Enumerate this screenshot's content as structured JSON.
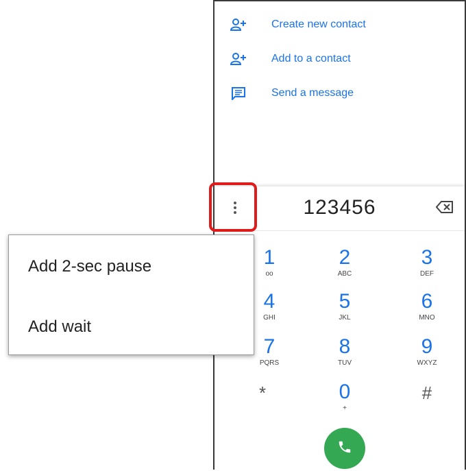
{
  "suggestions": [
    {
      "label": "Create new contact",
      "icon": "add-person-icon"
    },
    {
      "label": "Add to a contact",
      "icon": "add-person-icon"
    },
    {
      "label": "Send a message",
      "icon": "message-icon"
    }
  ],
  "dialer": {
    "number": "123456",
    "keys": [
      {
        "digit": "1",
        "letters": "oo"
      },
      {
        "digit": "2",
        "letters": "ABC"
      },
      {
        "digit": "3",
        "letters": "DEF"
      },
      {
        "digit": "4",
        "letters": "GHI"
      },
      {
        "digit": "5",
        "letters": "JKL"
      },
      {
        "digit": "6",
        "letters": "MNO"
      },
      {
        "digit": "7",
        "letters": "PQRS"
      },
      {
        "digit": "8",
        "letters": "TUV"
      },
      {
        "digit": "9",
        "letters": "WXYZ"
      },
      {
        "digit": "*",
        "letters": ""
      },
      {
        "digit": "0",
        "letters": "+"
      },
      {
        "digit": "#",
        "letters": ""
      }
    ]
  },
  "menu": {
    "items": [
      "Add 2-sec pause",
      "Add wait"
    ]
  },
  "colors": {
    "accent": "#1a73e8",
    "call": "#34a853",
    "highlight": "#e01b1b"
  }
}
